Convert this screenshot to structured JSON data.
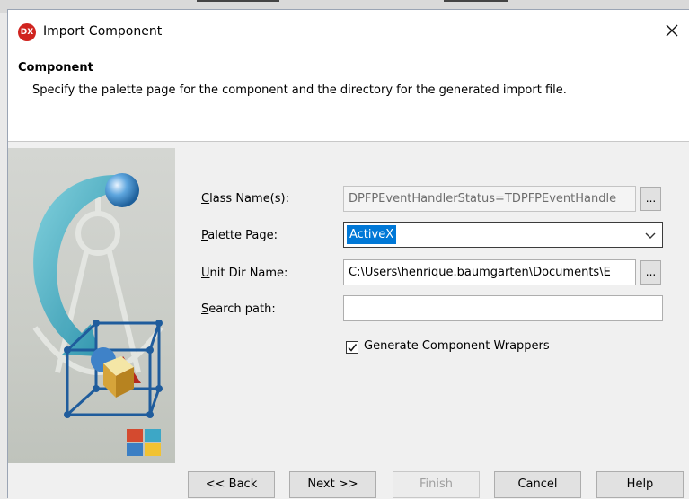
{
  "window": {
    "icon_text": "DX",
    "title": "Import Component"
  },
  "header": {
    "title": "Component",
    "subtitle": "Specify the palette page for the component and the directory for the generated import file."
  },
  "form": {
    "class_names": {
      "label_u": "C",
      "label_rest": "lass Name(s):",
      "value": "DPFPEventHandlerStatus=TDPFPEventHandle"
    },
    "palette_page": {
      "label_u": "P",
      "label_rest": "alette Page:",
      "value": "ActiveX"
    },
    "unit_dir": {
      "label_u": "U",
      "label_rest": "nit Dir Name:",
      "value": "C:\\Users\\henrique.baumgarten\\Documents\\E"
    },
    "search_path": {
      "label_u": "S",
      "label_rest": "earch path:",
      "value": ""
    },
    "generate_wrappers": {
      "label": "Generate Component Wrappers",
      "checked": true
    },
    "browse_label": "..."
  },
  "buttons": {
    "back": "<< Back",
    "next": "Next >>",
    "finish": "Finish",
    "cancel": "Cancel",
    "help": "Help"
  },
  "colors": {
    "accent": "#0078d7",
    "icon_red": "#d0241f"
  }
}
